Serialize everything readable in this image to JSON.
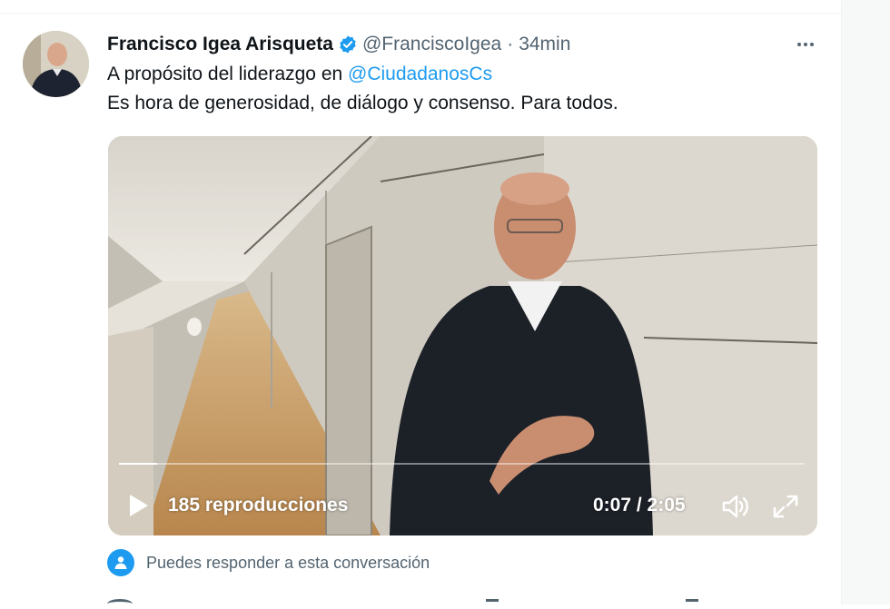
{
  "tweet": {
    "author_name": "Francisco Igea Arisqueta",
    "handle": "@FranciscoIgea",
    "separator": "·",
    "time": "34min",
    "line1_prefix": "A propósito del liderazgo en ",
    "mention": "@CiudadanosCs",
    "line2": "Es hora de generosidad, de diálogo y consenso. Para todos."
  },
  "video": {
    "views": "185 reproducciones",
    "current_time": "0:07",
    "time_separator": " / ",
    "duration": "2:05",
    "progress_fraction": 0.056
  },
  "conversation": {
    "reply_note": "Puedes responder a esta conversación"
  },
  "icons": {
    "verified": "verified-badge-icon",
    "more": "more-icon",
    "play": "play-icon",
    "volume": "volume-icon",
    "fullscreen": "fullscreen-icon",
    "reply": "people-icon"
  },
  "colors": {
    "accent": "#1d9bf0",
    "secondary_text": "#536471",
    "primary_text": "#0f1419"
  }
}
